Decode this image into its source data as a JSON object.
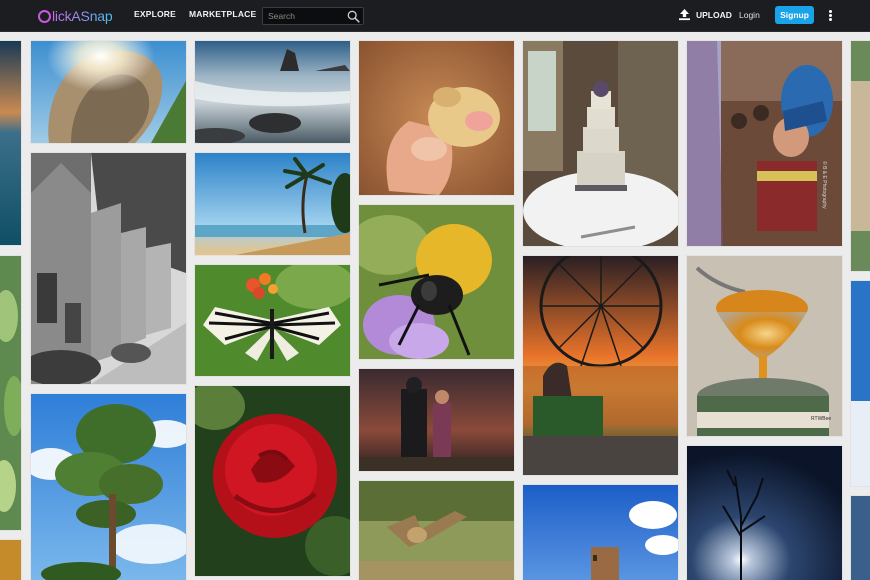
{
  "app": {
    "logo_text": "lickASnap",
    "brand_colors": {
      "logo_start": "#c86be8",
      "logo_end": "#4cc0f0",
      "signup_button": "#1aa3e8",
      "topbar_bg": "#1c1d20"
    }
  },
  "nav": {
    "explore": "EXPLORE",
    "marketplace": "MARKETPLACE"
  },
  "search": {
    "placeholder": "Search",
    "value": "",
    "icon": "search-icon"
  },
  "actions": {
    "upload": "UPLOAD",
    "upload_icon": "upload-icon",
    "login": "Login",
    "signup": "Signup",
    "more_icon": "kebab-menu-icon"
  },
  "photos": [
    {
      "subject": "ocean-edge-left-1"
    },
    {
      "subject": "plant-edge-left"
    },
    {
      "subject": "sculpture-head-with-sun"
    },
    {
      "subject": "stone-village-street-bw"
    },
    {
      "subject": "tall-pine-tree-blue-sky"
    },
    {
      "subject": "rocky-seascape"
    },
    {
      "subject": "palm-tree-beach-sunset"
    },
    {
      "subject": "paper-kite-butterfly"
    },
    {
      "subject": "red-rose-water-drops"
    },
    {
      "subject": "newborn-puppy-in-hand"
    },
    {
      "subject": "bumblebee-on-flower"
    },
    {
      "subject": "cosplay-couple-dusk"
    },
    {
      "subject": "owl-in-flight"
    },
    {
      "subject": "wedding-cake"
    },
    {
      "subject": "ferris-wheel-sunset"
    },
    {
      "subject": "desert-tower-blue-sky"
    },
    {
      "subject": "native-dancer-child"
    },
    {
      "subject": "honey-dipper-jar"
    },
    {
      "subject": "bare-tree-night-sky"
    },
    {
      "subject": "edge-right-strips"
    }
  ],
  "watermarks": {
    "dancer": "© B & E Photography",
    "honey": "RTWBee"
  }
}
